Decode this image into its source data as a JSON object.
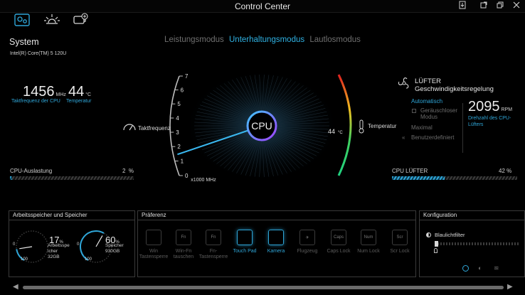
{
  "window": {
    "title": "Control Center",
    "buttons": [
      "window-mode-icon",
      "minimize-icon",
      "restore-icon",
      "close-icon"
    ]
  },
  "toolbar": {
    "icons": [
      "system-settings-icon",
      "display-brightness-icon",
      "battery-power-icon"
    ]
  },
  "modes": [
    {
      "label": "Leistungsmodus",
      "active": false
    },
    {
      "label": "Unterhaltungsmodus",
      "active": true
    },
    {
      "label": "Lautlosmodus",
      "active": false
    }
  ],
  "system": {
    "title": "System",
    "cpu_model": "Intel(R) Core(TM) 5 120U",
    "clock": {
      "value": "1456",
      "unit": "MHz",
      "label": "Taktfrequenz der CPU"
    },
    "temp": {
      "value": "44",
      "unit": "°C",
      "label": "Temperatur"
    },
    "cpu_load": {
      "label": "CPU-Auslastung",
      "value": "2",
      "unit": "%",
      "fraction": 0.02
    }
  },
  "gauge": {
    "center_label": "CPU",
    "left_label": "Taktfrequenz",
    "scale_ticks": [
      "0",
      "1",
      "2",
      "3",
      "4",
      "5",
      "6",
      "7"
    ],
    "scale_unit": "x1000 MHz",
    "needle_value": 1.456,
    "right_label": "Temperatur",
    "temp_value": "44",
    "temp_unit": "°C"
  },
  "fan": {
    "title_line1": "LÜFTER",
    "title_line2": "Geschwindigkeitsregelung",
    "options": {
      "auto": "Automatisch",
      "quiet_line1": "Geräuschloser",
      "quiet_line2": "Modus",
      "max": "Maximal",
      "custom": "Benutzerdefiniert"
    },
    "rpm": {
      "value": "2095",
      "unit": "RPM",
      "label_line1": "Drehzahl des CPU-",
      "label_line2": "Lüfters"
    },
    "cpu_fan": {
      "label": "CPU LÜFTER",
      "value": "42",
      "unit": "%",
      "fraction": 0.42
    }
  },
  "memory": {
    "title": "Arbeitsspeicher und Speicher",
    "ram": {
      "value": "17",
      "unit": "%",
      "label_line1": "Arbeitsspe",
      "label_line2": "icher",
      "size": "32GB",
      "fraction": 0.17
    },
    "storage": {
      "value": "60",
      "unit": "%",
      "label": "Speicher",
      "size": "930GB",
      "fraction": 0.6
    },
    "dial_labels": {
      "zero": "0",
      "hundred": "100"
    }
  },
  "prefs": {
    "title": "Präferenz",
    "items": [
      {
        "label1": "Win",
        "label2": "Tastensperre",
        "icon": "windows-key-icon",
        "glyph": "",
        "active": false
      },
      {
        "label1": "Win-Fn",
        "label2": "tauschen",
        "icon": "win-fn-swap-icon",
        "glyph": "Fn",
        "active": false
      },
      {
        "label1": "Fn-",
        "label2": "Tastensperre",
        "icon": "fn-lock-icon",
        "glyph": "Fn",
        "active": false
      },
      {
        "label1": "Touch Pad",
        "label2": "",
        "icon": "touchpad-icon",
        "glyph": "",
        "active": true
      },
      {
        "label1": "Kamera",
        "label2": "",
        "icon": "camera-icon",
        "glyph": "",
        "active": true
      },
      {
        "label1": "Flugzeug",
        "label2": "",
        "icon": "airplane-icon",
        "glyph": "✈",
        "active": false
      },
      {
        "label1": "Caps Lock",
        "label2": "",
        "icon": "caps-lock-icon",
        "glyph": "Caps",
        "active": false
      },
      {
        "label1": "Num Lock",
        "label2": "",
        "icon": "num-lock-icon",
        "glyph": "Num",
        "active": false
      },
      {
        "label1": "Scr Lock",
        "label2": "",
        "icon": "scroll-lock-icon",
        "glyph": "Scr",
        "active": false
      }
    ]
  },
  "config": {
    "title": "Konfiguration",
    "bluelight": "Blaulichtfilter"
  },
  "colors": {
    "accent": "#2fa6d8",
    "background": "#000000"
  }
}
